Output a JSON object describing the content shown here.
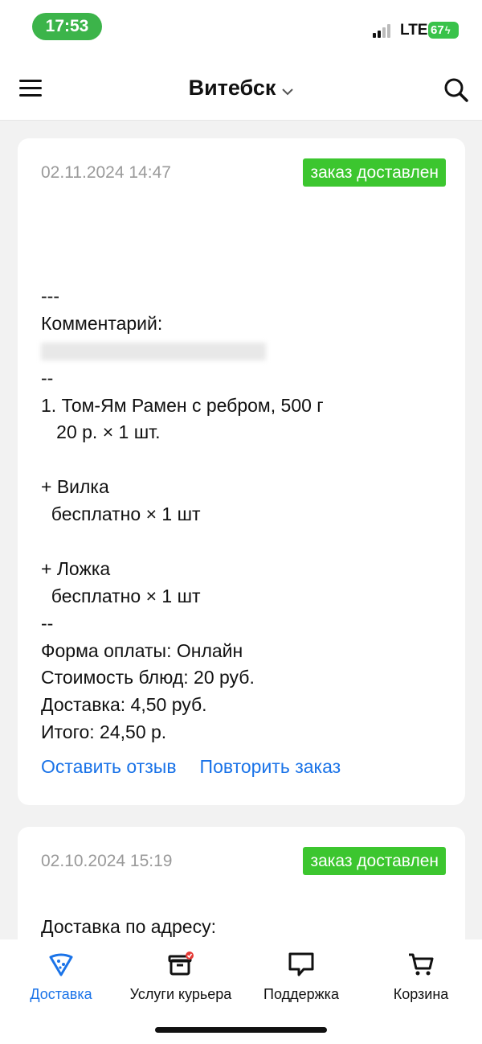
{
  "status_bar": {
    "time": "17:53",
    "network": "LTE",
    "battery": "67"
  },
  "header": {
    "city": "Витебск",
    "icons": {
      "menu": "hamburger-icon",
      "dropdown": "chevron-down-icon",
      "search": "search-icon"
    }
  },
  "orders": [
    {
      "date": "02.11.2024 14:47",
      "status": "заказ доставлен",
      "lines": [
        "---",
        "Комментарий:",
        "--",
        "1. Том-Ям Рамен с ребром, 500 г",
        "   20 р. × 1 шт.",
        "",
        "+ Вилка",
        "  бесплатно × 1 шт",
        "",
        "+ Ложка",
        "  бесплатно × 1 шт",
        "--",
        "Форма оплаты: Онлайн",
        "Стоимость блюд: 20 руб.",
        "Доставка: 4,50 руб.",
        "Итого: 24,50 р."
      ],
      "actions": {
        "review": "Оставить отзыв",
        "repeat": "Повторить заказ"
      }
    },
    {
      "date": "02.10.2024 15:19",
      "status": "заказ доставлен",
      "partial_line": "Доставка по адресу:"
    }
  ],
  "tabs": [
    {
      "label": "Доставка",
      "icon": "pizza-slice-icon",
      "active": true
    },
    {
      "label": "Услуги курьера",
      "icon": "courier-box-icon",
      "active": false
    },
    {
      "label": "Поддержка",
      "icon": "chat-bubble-icon",
      "active": false
    },
    {
      "label": "Корзина",
      "icon": "cart-icon",
      "active": false
    }
  ],
  "colors": {
    "accent": "#1a73e8",
    "status_green": "#3cc62f",
    "time_pill": "#3cb44a"
  }
}
